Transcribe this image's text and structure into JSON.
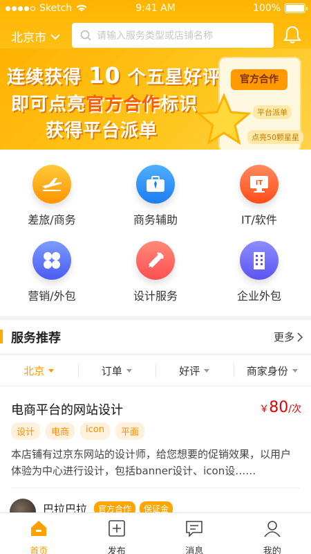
{
  "status_bar": {
    "carrier": "Sketch",
    "time": "9:41 AM",
    "battery": "100%"
  },
  "header": {
    "city": "北京市",
    "search_placeholder": "请输入服务类型或店铺名称"
  },
  "banner": {
    "line1_a": "连续获得",
    "line1_num": "10",
    "line1_b": "个五星好评",
    "line2_a": "即可点亮",
    "line2_hl": "官方合作",
    "line2_b": "标识",
    "line3": "获得平台派单",
    "badge": "官方合作",
    "tag_dispatch": "平台派单",
    "tag_stars": "点亮50颗星星"
  },
  "categories": [
    {
      "label": "差旅/商务",
      "icon": "airplane-icon"
    },
    {
      "label": "商务辅助",
      "icon": "briefcase-icon"
    },
    {
      "label": "IT/软件",
      "icon": "monitor-icon"
    },
    {
      "label": "营销/外包",
      "icon": "clover-icon"
    },
    {
      "label": "设计服务",
      "icon": "pencil-ruler-icon"
    },
    {
      "label": "企业外包",
      "icon": "building-icon"
    }
  ],
  "section": {
    "title": "服务推荐",
    "more": "更多"
  },
  "filters": [
    {
      "label": "北京",
      "active": true
    },
    {
      "label": "订单",
      "active": false
    },
    {
      "label": "好评",
      "active": false
    },
    {
      "label": "商家身份",
      "active": false
    }
  ],
  "listing": {
    "title": "电商平台的网站设计",
    "price_symbol": "￥",
    "price_value": "80",
    "price_unit": "/次",
    "tags": [
      "设计",
      "电商",
      "icon",
      "平面"
    ],
    "description": "本店铺有过京东网站的设计师，给您想要的促销效果，以用户体验为中心进行设计，包括banner设计、icon设……",
    "seller": "巴拉巴拉",
    "seller_badges": [
      "官方合作",
      "保证金"
    ]
  },
  "tabbar": [
    {
      "label": "首页",
      "icon": "home-icon",
      "active": true
    },
    {
      "label": "发布",
      "icon": "publish-icon",
      "active": false
    },
    {
      "label": "消息",
      "icon": "message-icon",
      "active": false
    },
    {
      "label": "我的",
      "icon": "profile-icon",
      "active": false
    }
  ],
  "colors": {
    "accent": "#ffaa00",
    "price": "#e60000",
    "tag_bg": "#fff1dc"
  }
}
